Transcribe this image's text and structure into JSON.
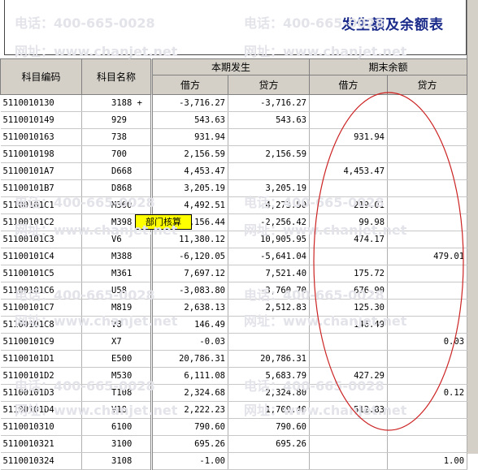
{
  "title": "发生额及余额表",
  "watermark": {
    "phone": "电话：400-665-0028",
    "site": "网址：www.chanjet.net"
  },
  "columns": {
    "code": "科目编码",
    "name": "科目名称",
    "current_period": "本期发生",
    "ending_balance": "期末余额",
    "debit": "借方",
    "credit": "贷方"
  },
  "badge": "部门核算",
  "rows": [
    {
      "code": "5110010130",
      "name": "3188 +",
      "cur_debit": "-3,716.27",
      "cur_credit": "-3,716.27",
      "end_debit": "",
      "end_credit": ""
    },
    {
      "code": "5110010149",
      "name": "929",
      "cur_debit": "543.63",
      "cur_credit": "543.63",
      "end_debit": "",
      "end_credit": ""
    },
    {
      "code": "5110010163",
      "name": "738",
      "cur_debit": "931.94",
      "cur_credit": "",
      "end_debit": "931.94",
      "end_credit": ""
    },
    {
      "code": "5110010198",
      "name": "700",
      "cur_debit": "2,156.59",
      "cur_credit": "2,156.59",
      "end_debit": "",
      "end_credit": ""
    },
    {
      "code": "51100101A7",
      "name": "D668",
      "cur_debit": "4,453.47",
      "cur_credit": "",
      "end_debit": "4,453.47",
      "end_credit": ""
    },
    {
      "code": "51100101B7",
      "name": "D868",
      "cur_debit": "3,205.19",
      "cur_credit": "3,205.19",
      "end_debit": "",
      "end_credit": ""
    },
    {
      "code": "51100101C1",
      "name": "M360",
      "cur_debit": "4,492.51",
      "cur_credit": "4,273.50",
      "end_debit": "219.01",
      "end_credit": ""
    },
    {
      "code": "51100101C2",
      "name": "M398",
      "cur_debit": "2,156.44",
      "cur_credit": "-2,256.42",
      "end_debit": "99.98",
      "end_credit": ""
    },
    {
      "code": "51100101C3",
      "name": "V6",
      "cur_debit": "11,380.12",
      "cur_credit": "10,905.95",
      "end_debit": "474.17",
      "end_credit": ""
    },
    {
      "code": "51100101C4",
      "name": "M388",
      "cur_debit": "-6,120.05",
      "cur_credit": "-5,641.04",
      "end_debit": "",
      "end_credit": "479.01"
    },
    {
      "code": "51100101C5",
      "name": "M361",
      "cur_debit": "7,697.12",
      "cur_credit": "7,521.40",
      "end_debit": "175.72",
      "end_credit": ""
    },
    {
      "code": "51100101C6",
      "name": "U58",
      "cur_debit": "-3,083.80",
      "cur_credit": "-3,760.70",
      "end_debit": "676.90",
      "end_credit": ""
    },
    {
      "code": "51100101C7",
      "name": "M819",
      "cur_debit": "2,638.13",
      "cur_credit": "2,512.83",
      "end_debit": "125.30",
      "end_credit": ""
    },
    {
      "code": "51100101C8",
      "name": "V8",
      "cur_debit": "146.49",
      "cur_credit": "",
      "end_debit": "146.49",
      "end_credit": ""
    },
    {
      "code": "51100101C9",
      "name": "X7",
      "cur_debit": "-0.03",
      "cur_credit": "",
      "end_debit": "",
      "end_credit": "0.03"
    },
    {
      "code": "51100101D1",
      "name": "E500",
      "cur_debit": "20,786.31",
      "cur_credit": "20,786.31",
      "end_debit": "",
      "end_credit": ""
    },
    {
      "code": "51100101D2",
      "name": "M530",
      "cur_debit": "6,111.08",
      "cur_credit": "5,683.79",
      "end_debit": "427.29",
      "end_credit": ""
    },
    {
      "code": "51100101D3",
      "name": "T108",
      "cur_debit": "2,324.68",
      "cur_credit": "2,324.80",
      "end_debit": "",
      "end_credit": "0.12"
    },
    {
      "code": "51100101D4",
      "name": "V18",
      "cur_debit": "2,222.23",
      "cur_credit": "1,709.40",
      "end_debit": "512.83",
      "end_credit": ""
    },
    {
      "code": "5110010310",
      "name": "6100",
      "cur_debit": "790.60",
      "cur_credit": "790.60",
      "end_debit": "",
      "end_credit": ""
    },
    {
      "code": "5110010321",
      "name": "3100",
      "cur_debit": "695.26",
      "cur_credit": "695.26",
      "end_debit": "",
      "end_credit": ""
    },
    {
      "code": "5110010324",
      "name": "3108",
      "cur_debit": "-1.00",
      "cur_credit": "",
      "end_debit": "",
      "end_credit": "1.00"
    }
  ],
  "colors": {
    "title": "#1a2a8a",
    "header_bg": "#d4d0c8",
    "badge_bg": "#ffff00",
    "annotation": "#cc2222",
    "watermark": "#e3e3ea"
  }
}
